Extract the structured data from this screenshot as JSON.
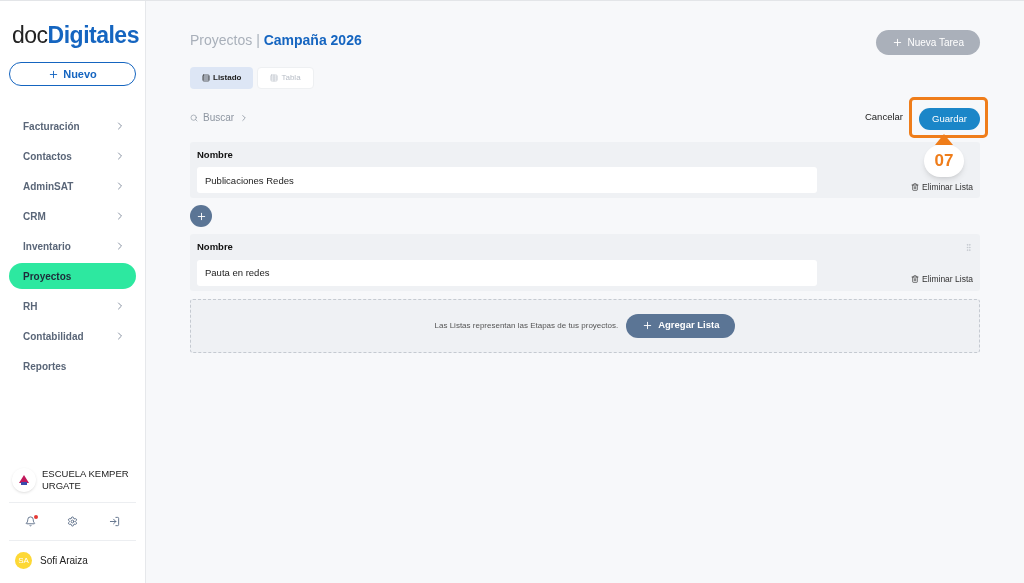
{
  "logo": {
    "light": "doc",
    "bold": "Digitales"
  },
  "new_button": {
    "label": "Nuevo"
  },
  "nav": [
    {
      "label": "Facturación",
      "has_submenu": true,
      "selected": false
    },
    {
      "label": "Contactos",
      "has_submenu": true,
      "selected": false
    },
    {
      "label": "AdminSAT",
      "has_submenu": true,
      "selected": false
    },
    {
      "label": "CRM",
      "has_submenu": true,
      "selected": false
    },
    {
      "label": "Inventario",
      "has_submenu": true,
      "selected": false
    },
    {
      "label": "Proyectos",
      "has_submenu": false,
      "selected": true
    },
    {
      "label": "RH",
      "has_submenu": true,
      "selected": false
    },
    {
      "label": "Contabilidad",
      "has_submenu": true,
      "selected": false
    },
    {
      "label": "Reportes",
      "has_submenu": false,
      "selected": false
    }
  ],
  "organization": {
    "name": "ESCUELA KEMPER URGATE"
  },
  "footer_icons": {
    "has_notification": true
  },
  "user": {
    "initials": "SA",
    "name": "Sofi Araiza"
  },
  "breadcrumb": {
    "section": "Proyectos",
    "separator": "|",
    "project": "Campaña 2026"
  },
  "new_task_button": {
    "label": "Nueva Tarea",
    "disabled": true
  },
  "view_tabs": [
    {
      "label": "Listado",
      "selected": true
    },
    {
      "label": "Tabla",
      "selected": false
    }
  ],
  "search": {
    "label": "Buscar"
  },
  "actions": {
    "cancel": "Cancelar",
    "save": "Guardar"
  },
  "callout": {
    "step": "07"
  },
  "lists": [
    {
      "field_label": "Nombre",
      "value": "Publicaciones Redes",
      "delete_label": "Eliminar Lista"
    },
    {
      "field_label": "Nombre",
      "value": "Pauta en redes",
      "delete_label": "Eliminar Lista"
    }
  ],
  "add_list": {
    "hint": "Las Listas representan las Etapas de tus proyectos.",
    "button": "Agregar Lista"
  }
}
